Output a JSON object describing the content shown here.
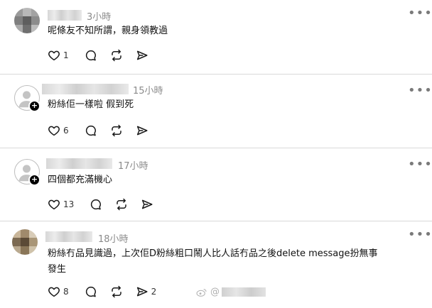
{
  "posts": [
    {
      "time": "3小時",
      "text": "呢條友不知所謂，親身領教過",
      "likes": "1",
      "reposts": "",
      "avatar": "pixel-gray"
    },
    {
      "time": "15小時",
      "text": "粉絲佢一樣啦 假到死",
      "likes": "6",
      "reposts": "",
      "avatar": "default-person"
    },
    {
      "time": "17小時",
      "text": "四個都充滿機心",
      "likes": "13",
      "reposts": "",
      "avatar": "default-person"
    },
    {
      "time": "18小時",
      "text": "粉絲冇品見識過，上次佢D粉絲粗口鬧人比人話冇品之後delete message扮無事\n發生",
      "likes": "8",
      "reposts": "2",
      "avatar": "pixel-brown"
    }
  ],
  "icons": {
    "like": "heart-icon",
    "comment": "comment-icon",
    "repost": "repost-icon",
    "share": "share-icon",
    "more": "more-icon",
    "follow": "follow-plus-icon"
  },
  "watermark": {
    "prefix": "@",
    "platform": "weibo-logo"
  },
  "colors": {
    "separator": "#d9d9d9",
    "time": "#8a8a8a",
    "icon": "#1a1a1a"
  }
}
